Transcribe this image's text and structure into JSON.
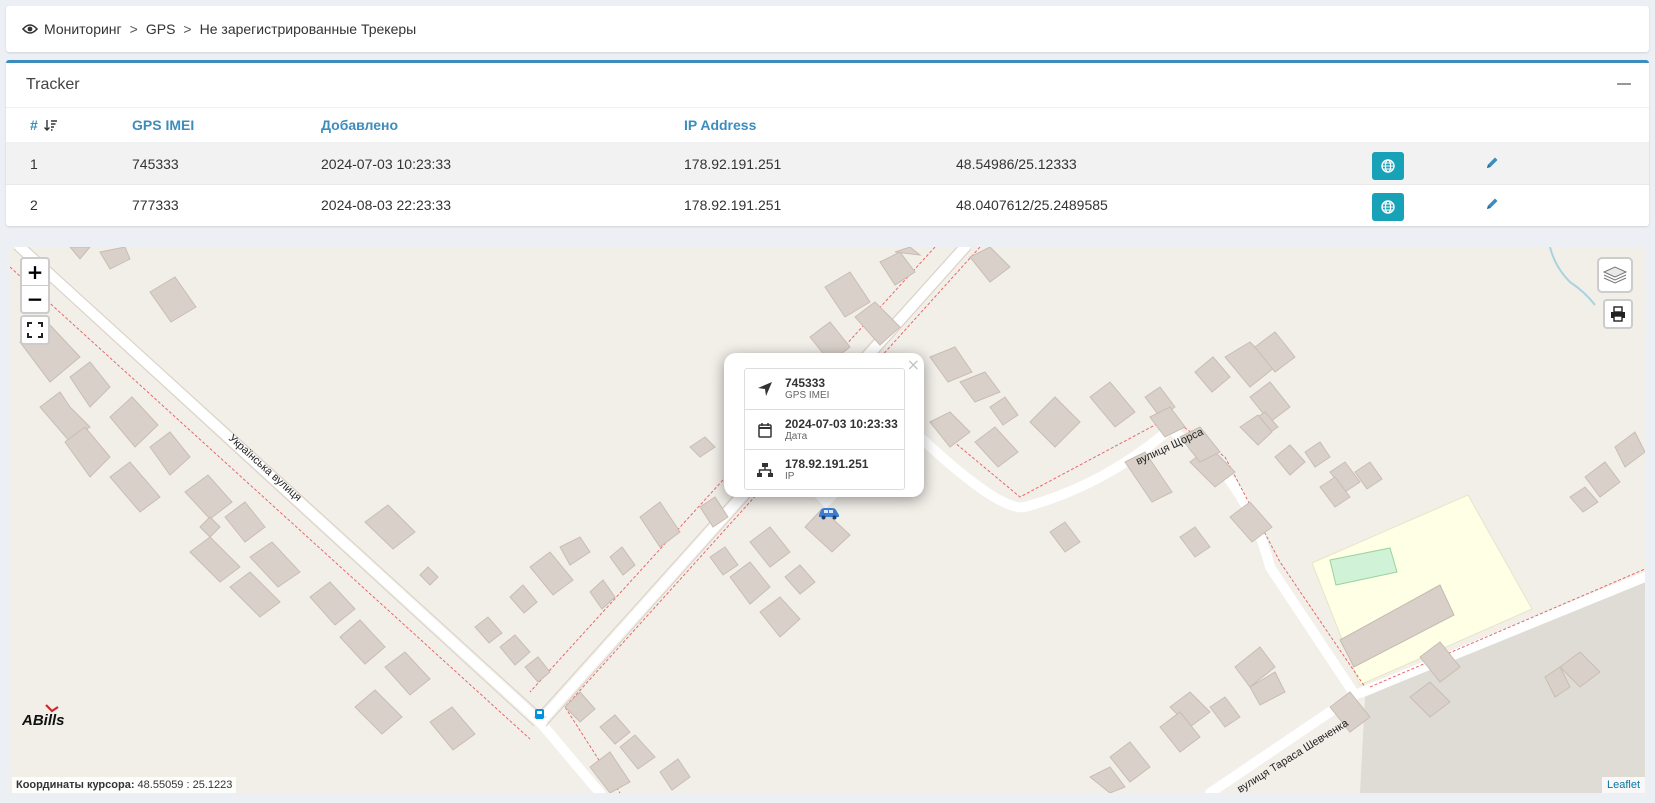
{
  "breadcrumb": {
    "items": [
      "Мониторинг",
      "GPS",
      "Не зарегистрированные Трекеры"
    ],
    "separator": ">"
  },
  "tracker": {
    "title": "Tracker",
    "columns": [
      "#",
      "GPS IMEI",
      "Добавлено",
      "IP Address",
      "",
      "",
      ""
    ],
    "rows": [
      {
        "num": "1",
        "imei": "745333",
        "added": "2024-07-03 10:23:33",
        "ip": "178.92.191.251",
        "coords": "48.54986/25.12333"
      },
      {
        "num": "2",
        "imei": "777333",
        "added": "2024-08-03 22:23:33",
        "ip": "178.92.191.251",
        "coords": "48.0407612/25.2489585"
      }
    ]
  },
  "map": {
    "zoom_in": "+",
    "zoom_out": "−",
    "popup": {
      "close": "×",
      "items": [
        {
          "icon": "location-arrow-icon",
          "value": "745333",
          "label": "GPS IMEI"
        },
        {
          "icon": "calendar-icon",
          "value": "2024-07-03 10:23:33",
          "label": "Дата"
        },
        {
          "icon": "network-icon",
          "value": "178.92.191.251",
          "label": "IP"
        }
      ]
    },
    "streets": [
      "Українська вулиця",
      "вулиця Щорса",
      "вулиця Тараса Шевченка"
    ],
    "coords_label": "Координаты курсора:",
    "coords_value": "48.55059 : 25.1223",
    "attribution": "Leaflet",
    "logo_text": "ABills"
  },
  "colors": {
    "accent": "#3c8dbc",
    "button_teal": "#17a2b8",
    "map_background": "#f2efe9",
    "building": "#d9d0c9"
  }
}
